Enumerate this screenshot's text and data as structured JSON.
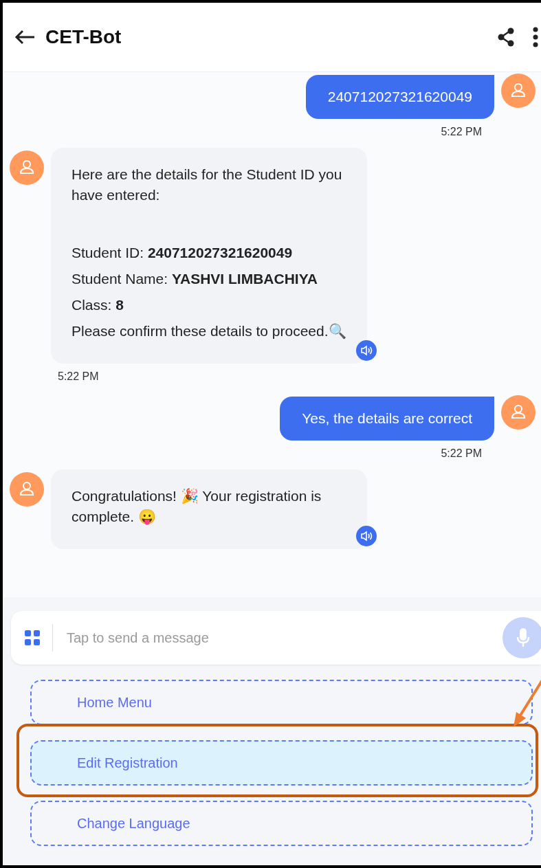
{
  "header": {
    "title": "CET-Bot"
  },
  "messages": [
    {
      "kind": "user",
      "lines": [
        "240712027321620049"
      ],
      "time": "5:22 PM"
    },
    {
      "kind": "bot",
      "lines": [
        "Here are the details for the Student ID you have entered:",
        "Student ID: **240712027321620049**",
        "Student Name: **YASHVI LIMBACHIYA**",
        "Class: **8**",
        "Please confirm these details to proceed.🔍"
      ],
      "time": "5:22 PM"
    },
    {
      "kind": "user",
      "lines": [
        "Yes, the details are correct"
      ],
      "time": "5:22 PM"
    },
    {
      "kind": "bot",
      "lines": [
        "Congratulations! 🎉 Your registration is complete. 😛"
      ]
    }
  ],
  "composer": {
    "placeholder": "Tap to send a message"
  },
  "quick_replies": [
    {
      "label": "Home Menu",
      "selected": false
    },
    {
      "label": "Edit Registration",
      "selected": true
    },
    {
      "label": "Change Language",
      "selected": false
    }
  ]
}
